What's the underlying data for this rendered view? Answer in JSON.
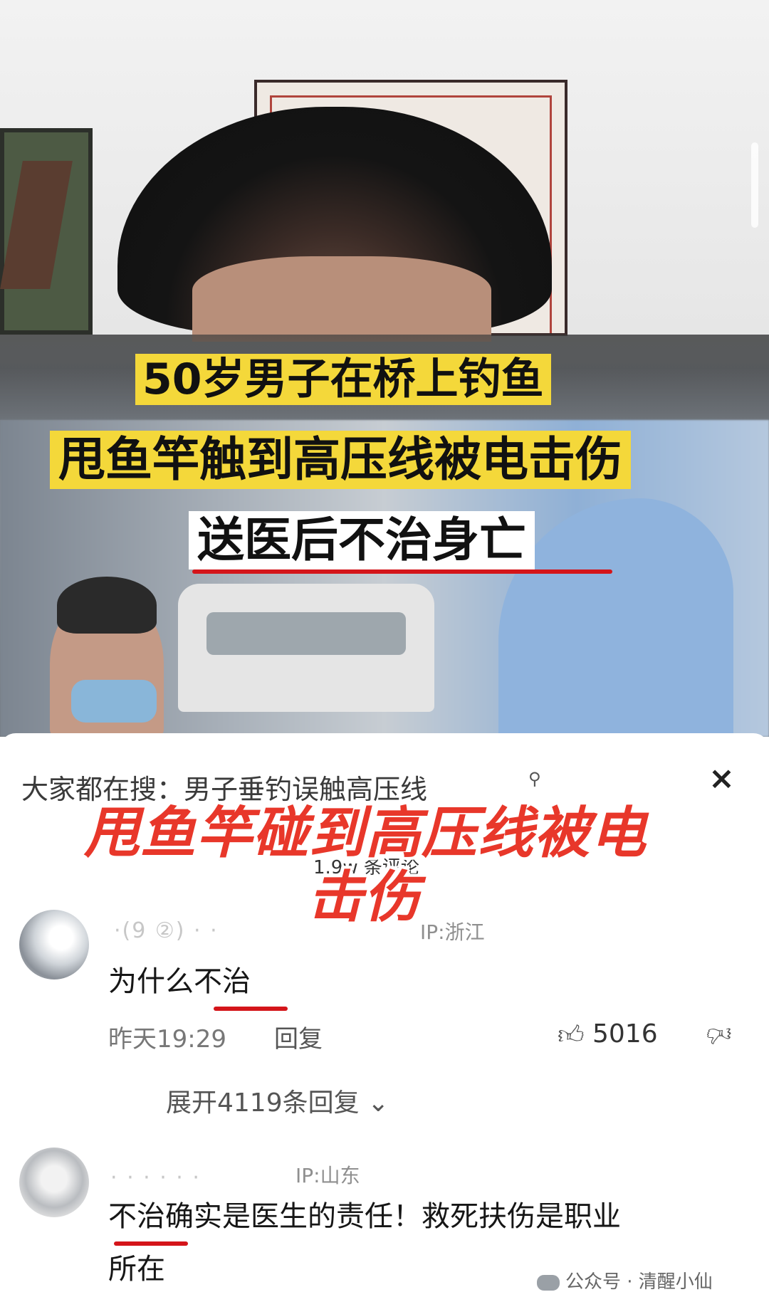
{
  "video": {
    "caption_line1": "50岁男子在桥上钓鱼",
    "caption_line2": "甩鱼竿触到高压线被电击伤",
    "caption_line3": "送医后不治身亡"
  },
  "panel": {
    "search_hint": "大家都在搜：男子垂钓误触高压线",
    "search_icon": "search-icon",
    "close_icon": "×",
    "comment_count": "1.9w 条评论",
    "overlay_line1": "甩鱼竿碰到高压线被电",
    "overlay_line2": "击伤"
  },
  "comments": [
    {
      "username": "·(9 ②) ·  ·",
      "ip": "IP:浙江",
      "text": "为什么不治",
      "time": "昨天19:29",
      "reply": "回复",
      "likes": "5016",
      "expand": "展开4119条回复"
    },
    {
      "username": "· · · · · ·",
      "ip": "IP:山东",
      "text_line1": "不治确实是医生的责任！救死扶伤是职业",
      "text_line2": "所在"
    }
  ],
  "watermark": {
    "text": "公众号 · 清醒小仙"
  },
  "colors": {
    "caption_yellow": "#f4d83a",
    "overlay_red": "#e8372a",
    "underline_red": "#d4151a"
  }
}
